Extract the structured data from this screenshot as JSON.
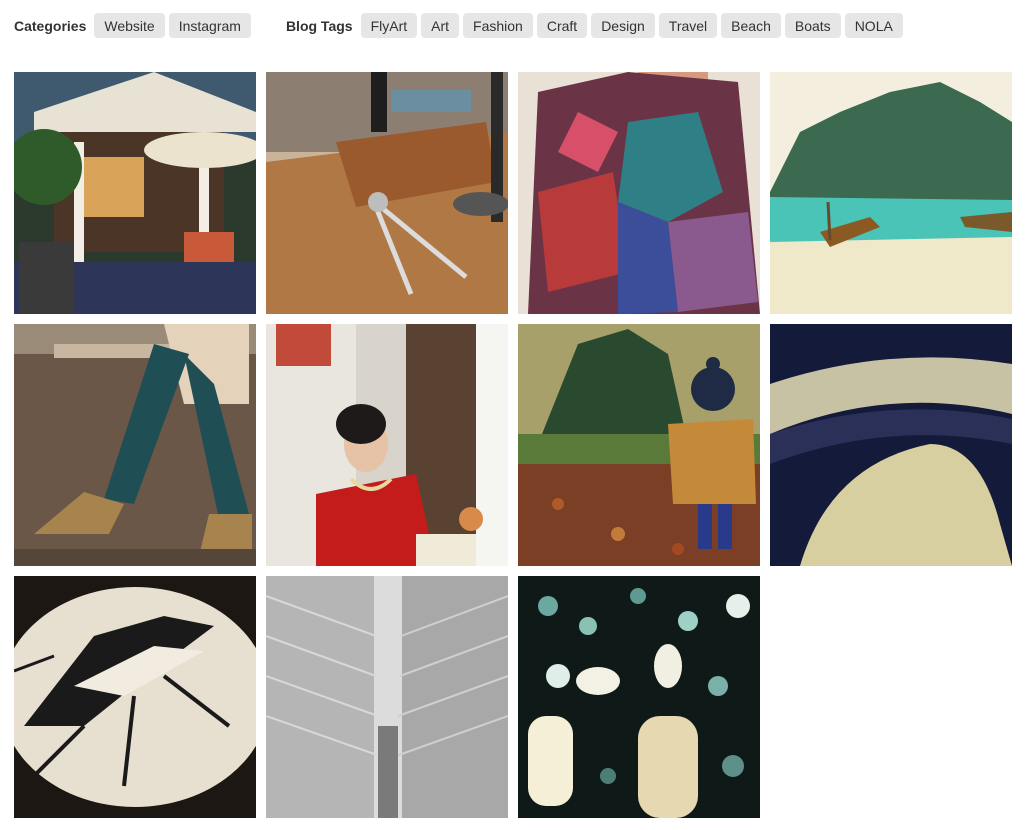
{
  "filters": {
    "categories_label": "Categories",
    "categories": [
      "Website",
      "Instagram"
    ],
    "tags_label": "Blog Tags",
    "tags": [
      "FlyArt",
      "Art",
      "Fashion",
      "Craft",
      "Design",
      "Travel",
      "Beach",
      "Boats",
      "NOLA"
    ]
  },
  "gallery": {
    "photos": [
      {
        "subject": "porch-with-umbrella"
      },
      {
        "subject": "leather-craft-desk"
      },
      {
        "subject": "patterned-blanket-wrap"
      },
      {
        "subject": "tropical-beach-boats"
      },
      {
        "subject": "walking-legs-boots"
      },
      {
        "subject": "woman-in-red-by-window"
      },
      {
        "subject": "child-in-autumn-leaves"
      },
      {
        "subject": "abstract-curve-blue"
      },
      {
        "subject": "moth-drawing-plate"
      },
      {
        "subject": "white-ribbed-architecture"
      },
      {
        "subject": "hanging-bottles-lights"
      }
    ]
  }
}
